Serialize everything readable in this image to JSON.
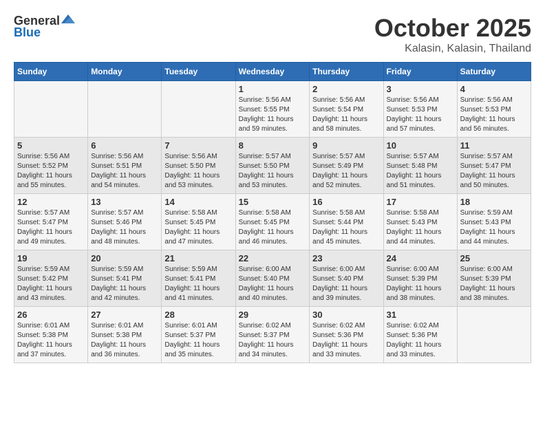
{
  "header": {
    "logo_general": "General",
    "logo_blue": "Blue",
    "month_title": "October 2025",
    "location": "Kalasin, Kalasin, Thailand"
  },
  "weekdays": [
    "Sunday",
    "Monday",
    "Tuesday",
    "Wednesday",
    "Thursday",
    "Friday",
    "Saturday"
  ],
  "weeks": [
    [
      {
        "day": "",
        "sunrise": "",
        "sunset": "",
        "daylight": ""
      },
      {
        "day": "",
        "sunrise": "",
        "sunset": "",
        "daylight": ""
      },
      {
        "day": "",
        "sunrise": "",
        "sunset": "",
        "daylight": ""
      },
      {
        "day": "1",
        "sunrise": "Sunrise: 5:56 AM",
        "sunset": "Sunset: 5:55 PM",
        "daylight": "Daylight: 11 hours and 59 minutes."
      },
      {
        "day": "2",
        "sunrise": "Sunrise: 5:56 AM",
        "sunset": "Sunset: 5:54 PM",
        "daylight": "Daylight: 11 hours and 58 minutes."
      },
      {
        "day": "3",
        "sunrise": "Sunrise: 5:56 AM",
        "sunset": "Sunset: 5:53 PM",
        "daylight": "Daylight: 11 hours and 57 minutes."
      },
      {
        "day": "4",
        "sunrise": "Sunrise: 5:56 AM",
        "sunset": "Sunset: 5:53 PM",
        "daylight": "Daylight: 11 hours and 56 minutes."
      }
    ],
    [
      {
        "day": "5",
        "sunrise": "Sunrise: 5:56 AM",
        "sunset": "Sunset: 5:52 PM",
        "daylight": "Daylight: 11 hours and 55 minutes."
      },
      {
        "day": "6",
        "sunrise": "Sunrise: 5:56 AM",
        "sunset": "Sunset: 5:51 PM",
        "daylight": "Daylight: 11 hours and 54 minutes."
      },
      {
        "day": "7",
        "sunrise": "Sunrise: 5:56 AM",
        "sunset": "Sunset: 5:50 PM",
        "daylight": "Daylight: 11 hours and 53 minutes."
      },
      {
        "day": "8",
        "sunrise": "Sunrise: 5:57 AM",
        "sunset": "Sunset: 5:50 PM",
        "daylight": "Daylight: 11 hours and 53 minutes."
      },
      {
        "day": "9",
        "sunrise": "Sunrise: 5:57 AM",
        "sunset": "Sunset: 5:49 PM",
        "daylight": "Daylight: 11 hours and 52 minutes."
      },
      {
        "day": "10",
        "sunrise": "Sunrise: 5:57 AM",
        "sunset": "Sunset: 5:48 PM",
        "daylight": "Daylight: 11 hours and 51 minutes."
      },
      {
        "day": "11",
        "sunrise": "Sunrise: 5:57 AM",
        "sunset": "Sunset: 5:47 PM",
        "daylight": "Daylight: 11 hours and 50 minutes."
      }
    ],
    [
      {
        "day": "12",
        "sunrise": "Sunrise: 5:57 AM",
        "sunset": "Sunset: 5:47 PM",
        "daylight": "Daylight: 11 hours and 49 minutes."
      },
      {
        "day": "13",
        "sunrise": "Sunrise: 5:57 AM",
        "sunset": "Sunset: 5:46 PM",
        "daylight": "Daylight: 11 hours and 48 minutes."
      },
      {
        "day": "14",
        "sunrise": "Sunrise: 5:58 AM",
        "sunset": "Sunset: 5:45 PM",
        "daylight": "Daylight: 11 hours and 47 minutes."
      },
      {
        "day": "15",
        "sunrise": "Sunrise: 5:58 AM",
        "sunset": "Sunset: 5:45 PM",
        "daylight": "Daylight: 11 hours and 46 minutes."
      },
      {
        "day": "16",
        "sunrise": "Sunrise: 5:58 AM",
        "sunset": "Sunset: 5:44 PM",
        "daylight": "Daylight: 11 hours and 45 minutes."
      },
      {
        "day": "17",
        "sunrise": "Sunrise: 5:58 AM",
        "sunset": "Sunset: 5:43 PM",
        "daylight": "Daylight: 11 hours and 44 minutes."
      },
      {
        "day": "18",
        "sunrise": "Sunrise: 5:59 AM",
        "sunset": "Sunset: 5:43 PM",
        "daylight": "Daylight: 11 hours and 44 minutes."
      }
    ],
    [
      {
        "day": "19",
        "sunrise": "Sunrise: 5:59 AM",
        "sunset": "Sunset: 5:42 PM",
        "daylight": "Daylight: 11 hours and 43 minutes."
      },
      {
        "day": "20",
        "sunrise": "Sunrise: 5:59 AM",
        "sunset": "Sunset: 5:41 PM",
        "daylight": "Daylight: 11 hours and 42 minutes."
      },
      {
        "day": "21",
        "sunrise": "Sunrise: 5:59 AM",
        "sunset": "Sunset: 5:41 PM",
        "daylight": "Daylight: 11 hours and 41 minutes."
      },
      {
        "day": "22",
        "sunrise": "Sunrise: 6:00 AM",
        "sunset": "Sunset: 5:40 PM",
        "daylight": "Daylight: 11 hours and 40 minutes."
      },
      {
        "day": "23",
        "sunrise": "Sunrise: 6:00 AM",
        "sunset": "Sunset: 5:40 PM",
        "daylight": "Daylight: 11 hours and 39 minutes."
      },
      {
        "day": "24",
        "sunrise": "Sunrise: 6:00 AM",
        "sunset": "Sunset: 5:39 PM",
        "daylight": "Daylight: 11 hours and 38 minutes."
      },
      {
        "day": "25",
        "sunrise": "Sunrise: 6:00 AM",
        "sunset": "Sunset: 5:39 PM",
        "daylight": "Daylight: 11 hours and 38 minutes."
      }
    ],
    [
      {
        "day": "26",
        "sunrise": "Sunrise: 6:01 AM",
        "sunset": "Sunset: 5:38 PM",
        "daylight": "Daylight: 11 hours and 37 minutes."
      },
      {
        "day": "27",
        "sunrise": "Sunrise: 6:01 AM",
        "sunset": "Sunset: 5:38 PM",
        "daylight": "Daylight: 11 hours and 36 minutes."
      },
      {
        "day": "28",
        "sunrise": "Sunrise: 6:01 AM",
        "sunset": "Sunset: 5:37 PM",
        "daylight": "Daylight: 11 hours and 35 minutes."
      },
      {
        "day": "29",
        "sunrise": "Sunrise: 6:02 AM",
        "sunset": "Sunset: 5:37 PM",
        "daylight": "Daylight: 11 hours and 34 minutes."
      },
      {
        "day": "30",
        "sunrise": "Sunrise: 6:02 AM",
        "sunset": "Sunset: 5:36 PM",
        "daylight": "Daylight: 11 hours and 33 minutes."
      },
      {
        "day": "31",
        "sunrise": "Sunrise: 6:02 AM",
        "sunset": "Sunset: 5:36 PM",
        "daylight": "Daylight: 11 hours and 33 minutes."
      },
      {
        "day": "",
        "sunrise": "",
        "sunset": "",
        "daylight": ""
      }
    ]
  ]
}
